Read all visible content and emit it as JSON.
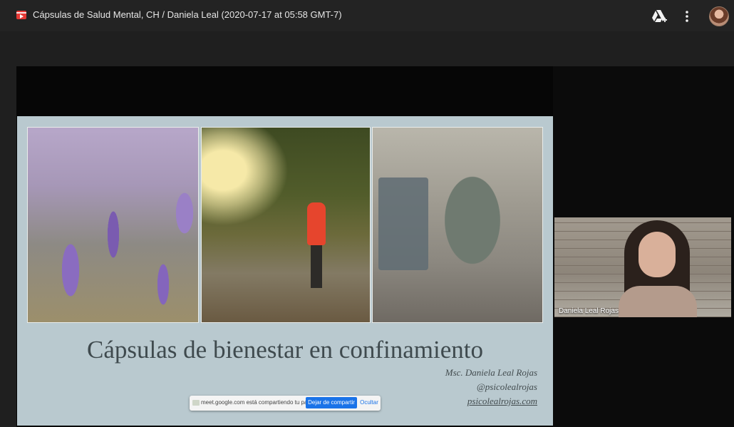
{
  "header": {
    "title": "Cápsulas de Salud Mental, CH / Daniela Leal (2020-07-17 at 05:58 GMT-7)",
    "icons": [
      "video-file-icon",
      "drive-add-icon",
      "more-vert-icon",
      "avatar"
    ]
  },
  "slide": {
    "title": "Cápsulas de bienestar en confinamiento",
    "author": "Msc. Daniela Leal Rojas",
    "handle": "@psicolealrojas",
    "website": "psicolealrojas.com"
  },
  "share_bar": {
    "message": "meet.google.com está compartiendo tu pantalla.",
    "stop_label": "Dejar de compartir",
    "hide_label": "Ocultar"
  },
  "participant": {
    "name": "Daniela Leal Rojas"
  },
  "colors": {
    "background": "#1f1f1f",
    "accent": "#1a73e8",
    "file_icon": "#e53935"
  }
}
